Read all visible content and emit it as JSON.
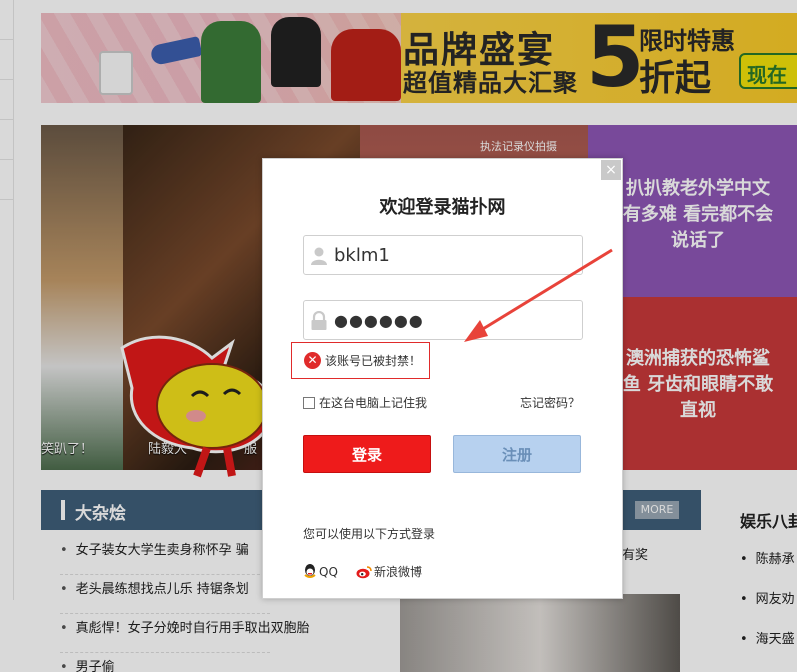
{
  "banner": {
    "title_main": "品牌盛宴",
    "title_sub": "超值精品大汇聚",
    "five": "5",
    "limited": "限时特惠",
    "discount": "折起",
    "now": "现在"
  },
  "tiles": {
    "caption1": "笑趴了！",
    "caption2": "陆毅大",
    "caption2b": "服",
    "purple_text": "扒扒教老外学中文\n有多难 看完都不会\n说话了",
    "red_text": "澳洲捕获的恐怖鲨\n鱼 牙齿和眼睛不敢\n直视",
    "tag": "执法记录仪拍摄"
  },
  "section": {
    "title": "大杂烩",
    "more": "MORE",
    "items": [
      "女子装女大学生卖身称怀孕 骗",
      "老头晨练想找点儿乐 持锯条划",
      "真彪悍！女子分娩时自行用手取出双胞胎",
      "男子偷"
    ],
    "mid_text": "有奖"
  },
  "right": {
    "title": "娱乐八卦",
    "items": [
      "陈赫承",
      "网友劝",
      "海天盛"
    ]
  },
  "login": {
    "title": "欢迎登录猫扑网",
    "close": "×",
    "username": "bklm1",
    "password": "●●●●●●",
    "error": "该账号已被封禁！",
    "remember": "在这台电脑上记住我",
    "forgot": "忘记密码？",
    "login_btn": "登录",
    "register_btn": "注册",
    "alt_login": "您可以使用以下方式登录",
    "qq": "QQ",
    "weibo": "新浪微博"
  },
  "colors": {
    "login_red": "#ee1b1b",
    "register_blue": "#b7d1ef",
    "error_red": "#e02b2b",
    "section_blue": "#3f5e7a",
    "annotation": "#e8433a"
  }
}
